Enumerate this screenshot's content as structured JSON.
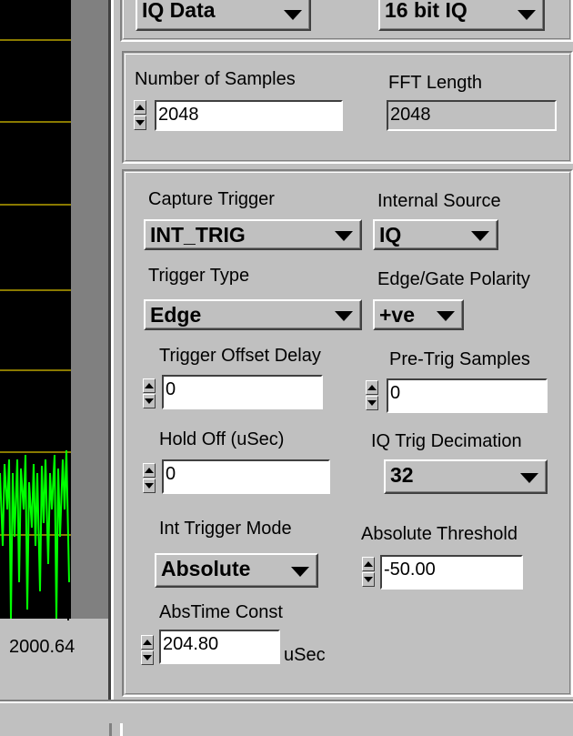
{
  "top_panel": {
    "data_type_ring": "IQ Data",
    "format_ring": "16 bit IQ"
  },
  "samples_panel": {
    "number_of_samples_label": "Number of Samples",
    "number_of_samples_value": "2048",
    "fft_length_label": "FFT Length",
    "fft_length_value": "2048"
  },
  "trigger_panel": {
    "capture_trigger_label": "Capture Trigger",
    "capture_trigger_value": "INT_TRIG",
    "internal_source_label": "Internal Source",
    "internal_source_value": "IQ",
    "trigger_type_label": "Trigger Type",
    "trigger_type_value": "Edge",
    "edge_gate_polarity_label": "Edge/Gate Polarity",
    "edge_gate_polarity_value": "+ve",
    "trigger_offset_delay_label": "Trigger Offset Delay",
    "trigger_offset_delay_value": "0",
    "pre_trig_samples_label": "Pre-Trig Samples",
    "pre_trig_samples_value": "0",
    "hold_off_label": "Hold Off (uSec)",
    "hold_off_value": "0",
    "iq_trig_decimation_label": "IQ Trig Decimation",
    "iq_trig_decimation_value": "32",
    "int_trigger_mode_label": "Int Trigger Mode",
    "int_trigger_mode_value": "Absolute",
    "absolute_threshold_label": "Absolute Threshold",
    "absolute_threshold_value": "-50.00",
    "abstime_const_label": "AbsTime Const",
    "abstime_const_value": "204.80",
    "abstime_const_unit": "uSec"
  },
  "plot": {
    "x_tick_label": "2000.64",
    "trace_color": "#00ff00",
    "grid_color": "#8a7a00",
    "background_color": "#000000"
  }
}
